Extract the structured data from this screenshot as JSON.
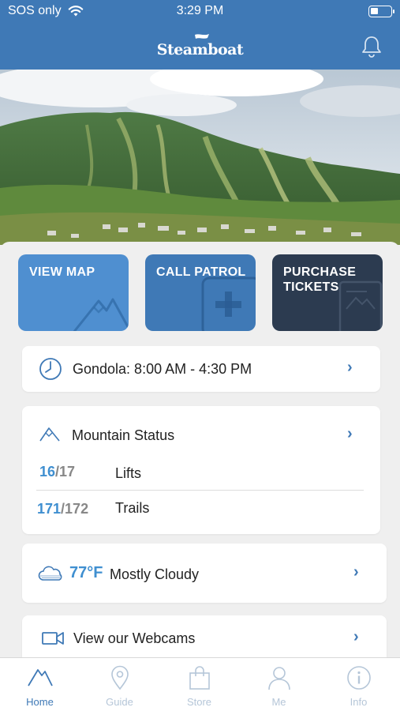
{
  "status_bar": {
    "carrier": "SOS only",
    "time": "3:29 PM"
  },
  "header": {
    "logo_text": "Steamboat"
  },
  "hero": {
    "image": "mountain-landscape"
  },
  "tiles": [
    {
      "label": "VIEW MAP",
      "icon": "mountain-icon"
    },
    {
      "label": "CALL PATROL",
      "icon": "plus-icon"
    },
    {
      "label": "PURCHASE TICKETS",
      "icon": "ticket-icon"
    }
  ],
  "gondola": {
    "icon": "clock-icon",
    "text": "Gondola: 8:00 AM - 4:30 PM"
  },
  "mountain_status": {
    "icon": "mountain-outline-icon",
    "title": "Mountain Status",
    "rows": [
      {
        "open": "16",
        "total": "/17",
        "label": "Lifts"
      },
      {
        "open": "171",
        "total": "/172",
        "label": "Trails"
      }
    ]
  },
  "weather": {
    "icon": "cloud-icon",
    "temp": "77°F",
    "condition": "Mostly Cloudy"
  },
  "webcams": {
    "icon": "video-camera-icon",
    "text": "View our Webcams"
  },
  "tabbar": {
    "tabs": [
      {
        "label": "Home",
        "icon": "home-mountain-icon",
        "active": true
      },
      {
        "label": "Guide",
        "icon": "map-pin-icon",
        "active": false
      },
      {
        "label": "Store",
        "icon": "shopping-bag-icon",
        "active": false
      },
      {
        "label": "Me",
        "icon": "person-icon",
        "active": false
      },
      {
        "label": "Info",
        "icon": "info-icon",
        "active": false
      }
    ]
  },
  "colors": {
    "brand_blue": "#3f79b6",
    "light_blue": "#4f8fd0",
    "navy": "#2c3b50",
    "inactive_tab": "#b5c6d8"
  }
}
